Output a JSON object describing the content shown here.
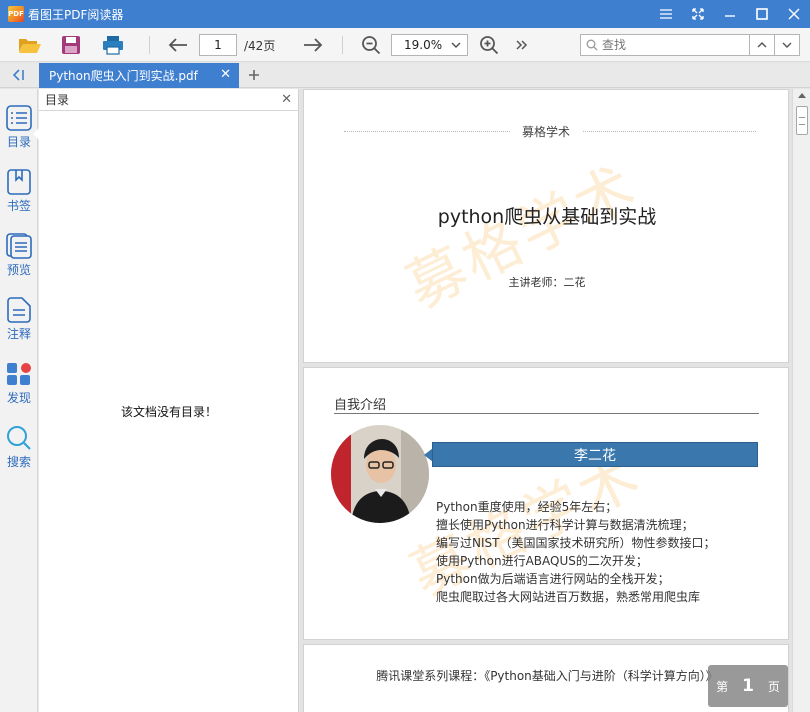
{
  "window": {
    "title": "看图王PDF阅读器",
    "logo_text": "PDF"
  },
  "toolbar": {
    "current_page": "1",
    "page_total": "/42页",
    "zoom": "19.0%",
    "search_placeholder": "查找"
  },
  "tabs": [
    {
      "label": "Python爬虫入门到实战.pdf"
    }
  ],
  "sidebar": {
    "items": [
      {
        "label": "目录",
        "icon": "toc-icon"
      },
      {
        "label": "书签",
        "icon": "bookmark-icon"
      },
      {
        "label": "预览",
        "icon": "preview-icon"
      },
      {
        "label": "注释",
        "icon": "annotation-icon"
      },
      {
        "label": "发现",
        "icon": "discover-icon"
      },
      {
        "label": "搜索",
        "icon": "search-icon"
      }
    ]
  },
  "toc_panel": {
    "title": "目录",
    "empty_message": "该文档没有目录！"
  },
  "document": {
    "watermark": "募格学术",
    "page1": {
      "brand": "募格学术",
      "title": "python爬虫从基础到实战",
      "subtitle": "主讲老师：二花"
    },
    "page2": {
      "heading": "自我介绍",
      "name": "李二花",
      "bio": [
        "Python重度使用，经验5年左右；",
        "擅长使用Python进行科学计算与数据清洗梳理；",
        "编写过NIST（美国国家技术研究所）物性参数接口；",
        "使用Python进行ABAQUS的二次开发；",
        "Python做为后端语言进行网站的全栈开发；",
        "爬虫爬取过各大网站进百万数据，熟悉常用爬虫库"
      ]
    },
    "page3": {
      "text": "腾讯课堂系列课程：《Python基础入门与进阶（科学计算方向）》"
    }
  },
  "page_badge": {
    "prefix": "第",
    "number": "1",
    "suffix": "页"
  },
  "colors": {
    "titlebar": "#3f7fd0",
    "accent": "#2d6bbd",
    "namebar": "#3a77ad"
  }
}
